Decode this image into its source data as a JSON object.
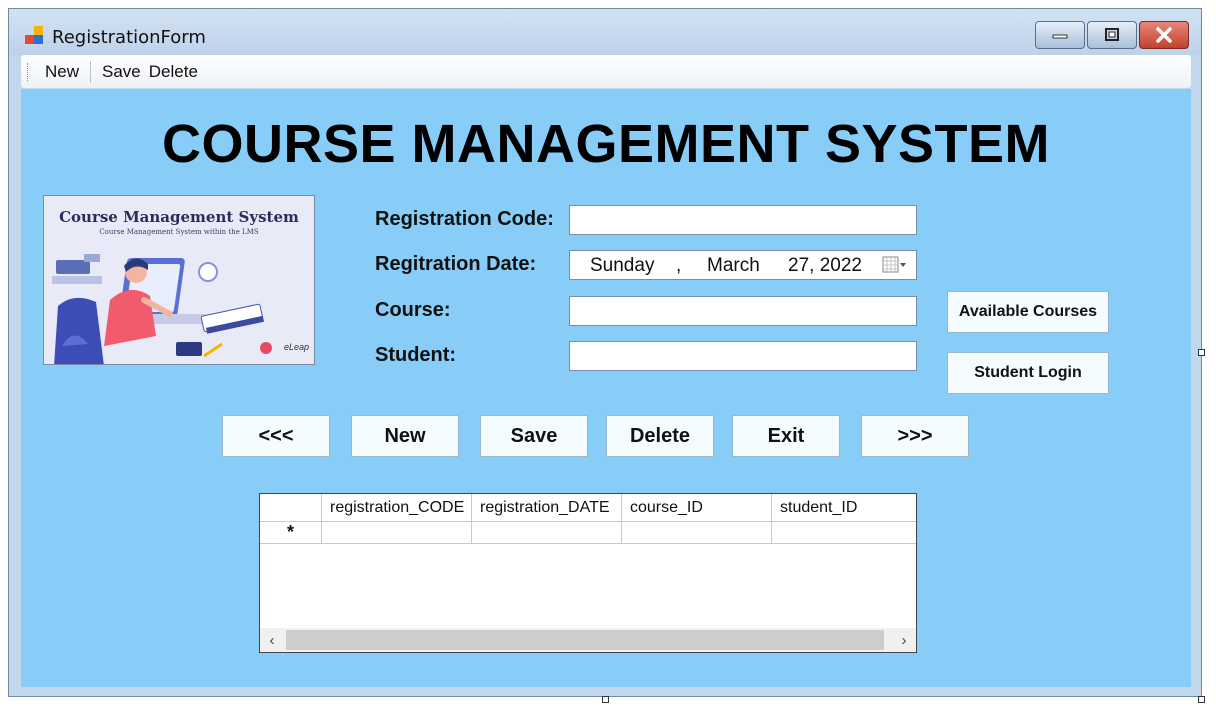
{
  "window": {
    "title": "RegistrationForm"
  },
  "menu": {
    "items": [
      "New",
      "Save",
      "Delete"
    ]
  },
  "heading": "COURSE MANAGEMENT SYSTEM",
  "illustration": {
    "title": "Course Management System",
    "subtitle": "Course Management System within the LMS",
    "logo": "eLeap"
  },
  "form": {
    "registration_code": {
      "label": "Registration Code:",
      "value": ""
    },
    "registration_date": {
      "label": "Regitration Date:",
      "weekday": "Sunday",
      "comma": ",",
      "month": "March",
      "day_year": "27, 2022"
    },
    "course": {
      "label": "Course:",
      "value": ""
    },
    "student": {
      "label": "Student:",
      "value": ""
    }
  },
  "side_buttons": {
    "available_courses": "Available Courses",
    "student_login": "Student Login"
  },
  "nav_buttons": {
    "prev": "<<<",
    "new": "New",
    "save": "Save",
    "delete": "Delete",
    "exit": "Exit",
    "next": ">>>"
  },
  "grid": {
    "columns": [
      "registration_CODE",
      "registration_DATE",
      "course_ID",
      "student_ID"
    ],
    "new_row_marker": "*"
  },
  "colors": {
    "client_background": "#87cdf8",
    "button_face": "#f5fcff",
    "close_button": "#c2412d"
  }
}
